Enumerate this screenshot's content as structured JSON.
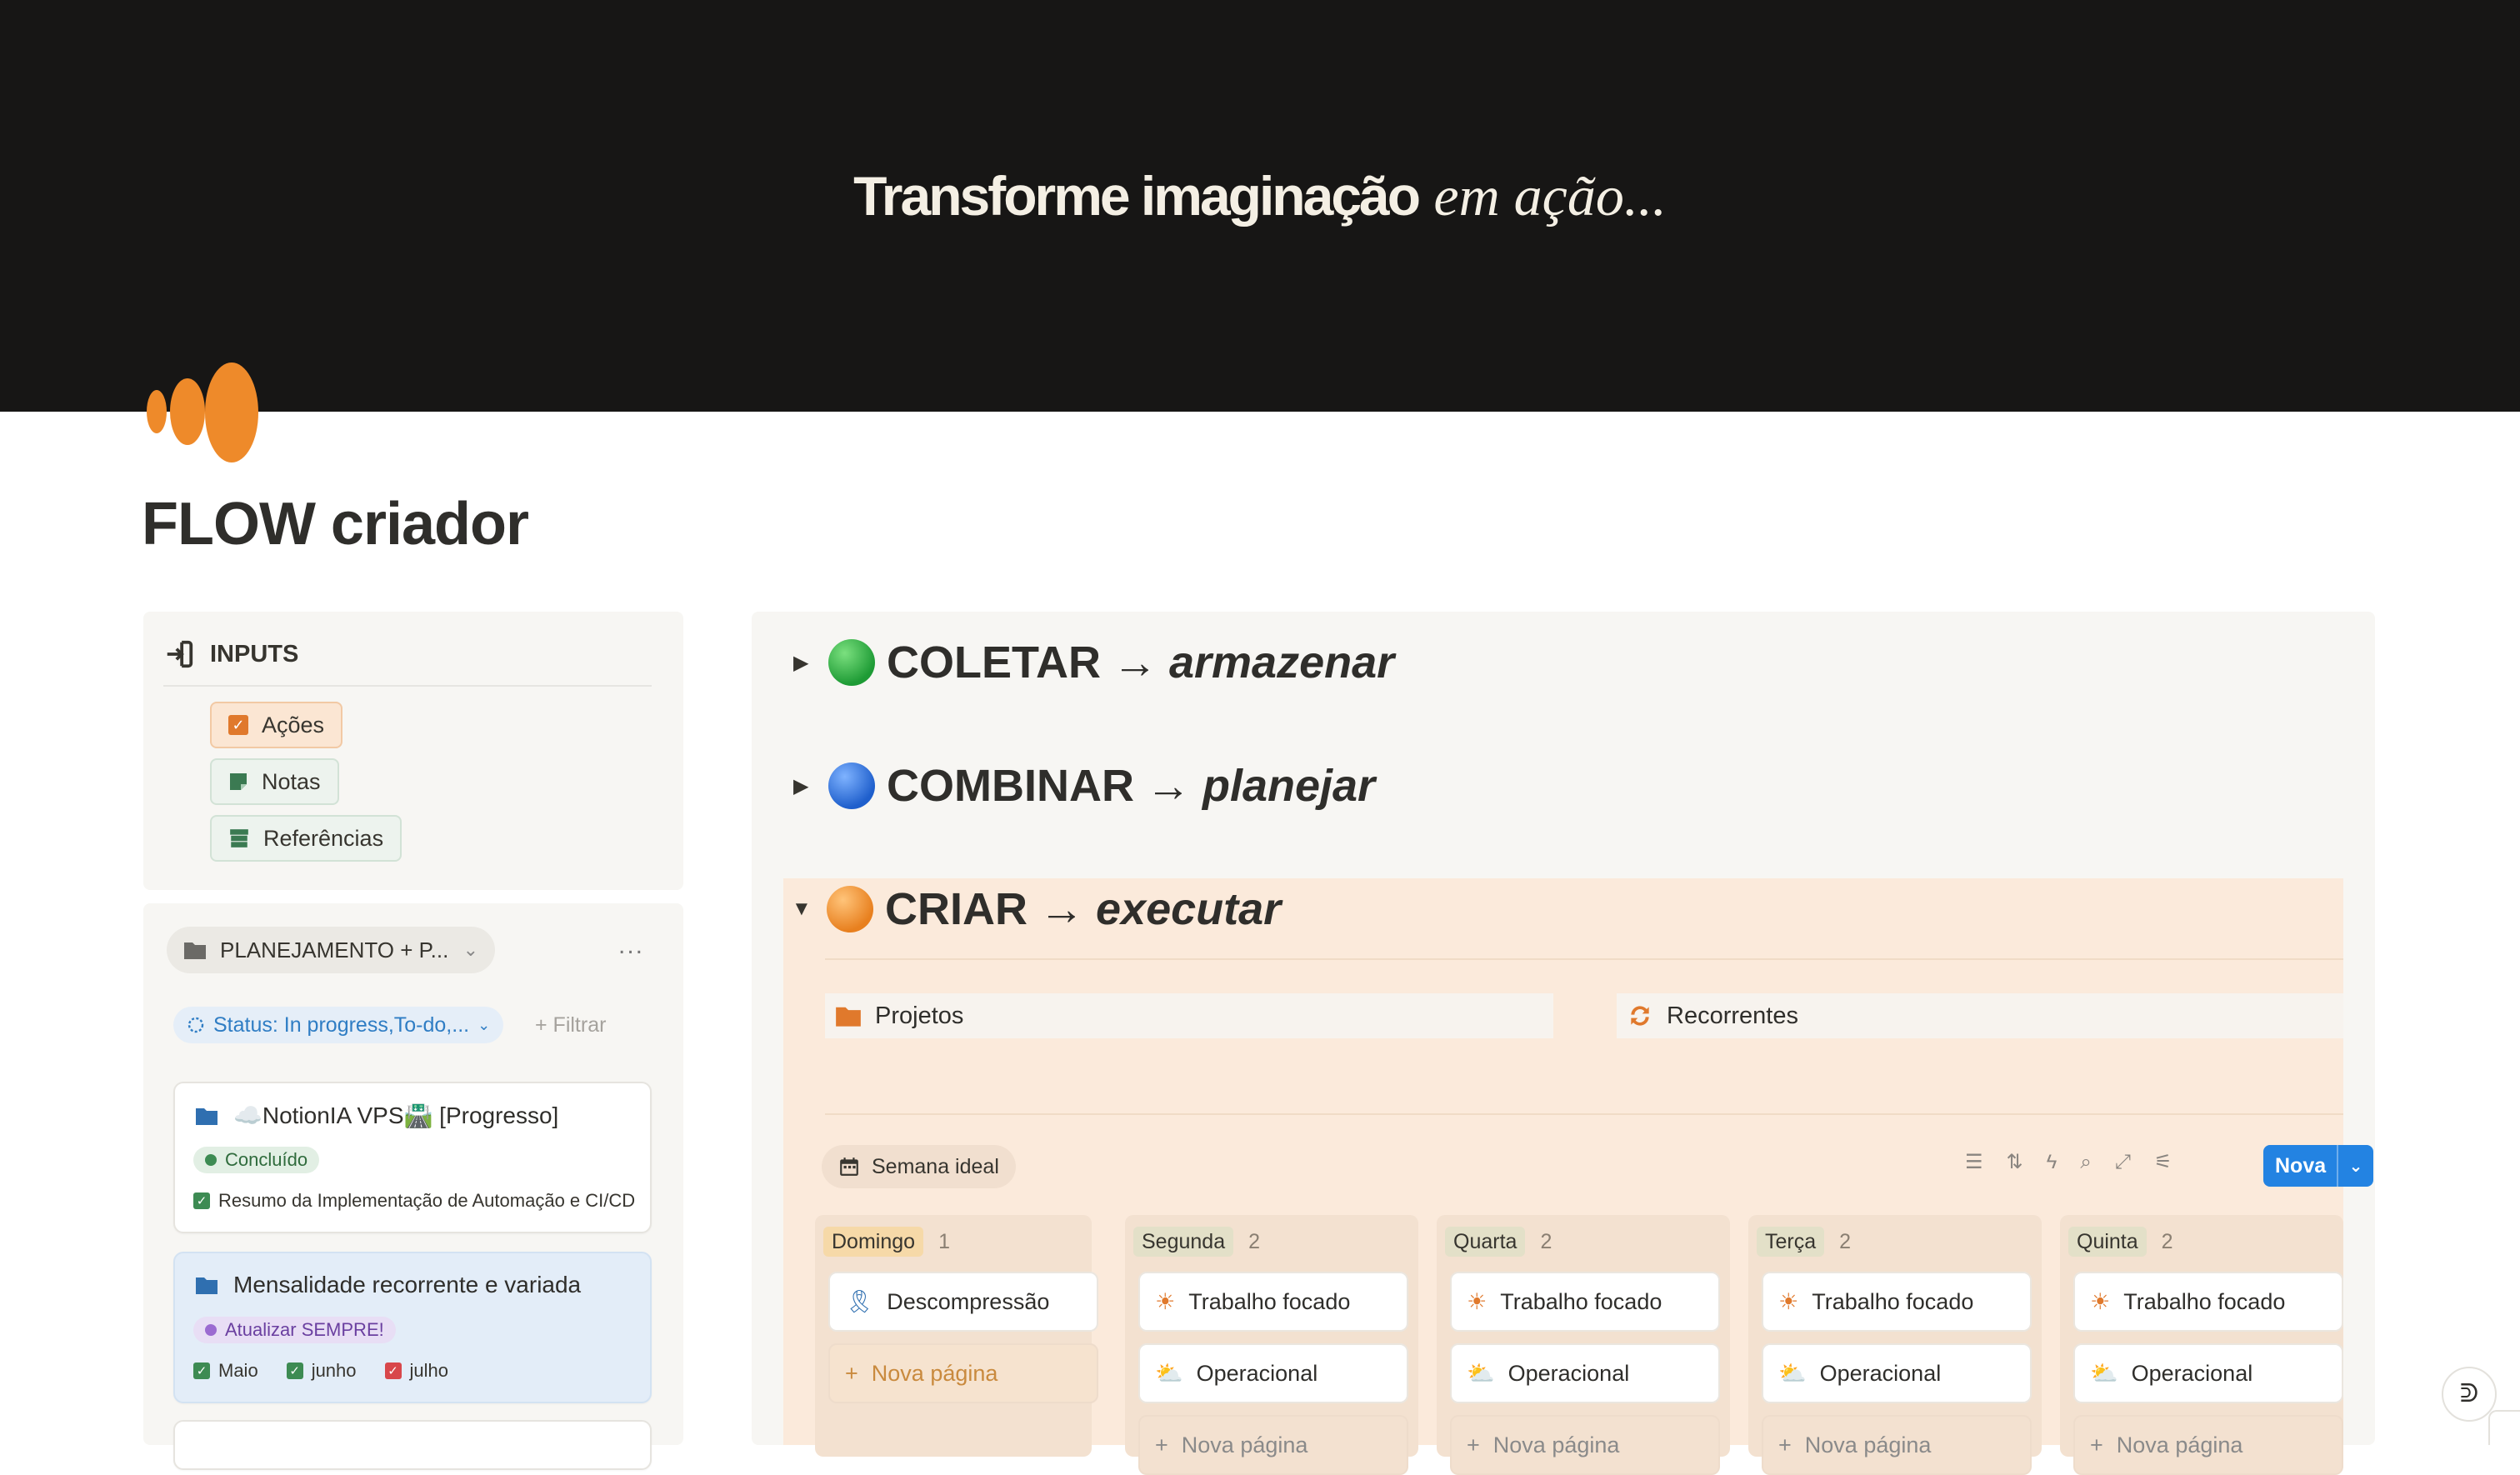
{
  "cover": {
    "title_bold": "Transforme imaginação",
    "title_italic": "em ação..."
  },
  "page": {
    "title": "FLOW criador"
  },
  "inputs": {
    "heading": "INPUTS",
    "items": [
      {
        "label": "Ações",
        "icon": "checkbox-icon",
        "color": "#e0792c"
      },
      {
        "label": "Notas",
        "icon": "note-icon",
        "color": "#3b7a52"
      },
      {
        "label": "Referências",
        "icon": "archive-icon",
        "color": "#3b7a52"
      }
    ]
  },
  "planning": {
    "view_label": "PLANEJAMENTO + P...",
    "more": "...",
    "status_filter": "Status: In progress,To-do,...",
    "add_filter": "+ Filtrar",
    "cards": [
      {
        "title": "☁️NotionIA VPS🛣️ [Progresso]",
        "tag": "Concluído",
        "relation": "Resumo da Implementação de Automação e CI/CD"
      },
      {
        "title": "Mensalidade recorrente e variada",
        "tag": "Atualizar SEMPRE!",
        "relations": [
          "Maio",
          "junho",
          "julho"
        ]
      }
    ]
  },
  "toggles": [
    {
      "emoji_color": "#2fa742",
      "main": "COLETAR",
      "arrow": "→",
      "sub": "armazenar",
      "state": "collapsed"
    },
    {
      "emoji_color": "#2f6fd6",
      "main": "COMBINAR",
      "arrow": "→",
      "sub": "planejar",
      "state": "collapsed"
    },
    {
      "emoji_color": "#ee8a2a",
      "main": "CRIAR",
      "arrow": "→",
      "sub": "executar",
      "state": "expanded"
    }
  ],
  "criar": {
    "links": [
      {
        "label": "Projetos",
        "icon": "folder-icon"
      },
      {
        "label": "Recorrentes",
        "icon": "repeat-icon"
      }
    ],
    "view_tab": "Semana ideal",
    "new_button": "Nova",
    "new_page": "Nova página",
    "columns": [
      {
        "label": "Domingo",
        "count": "1",
        "label_bg": "#f6d9a8",
        "cards": [
          {
            "title": "Descompressão",
            "icon": "ribbon-icon"
          }
        ]
      },
      {
        "label": "Segunda",
        "count": "2",
        "label_bg": "#e3e0c8",
        "cards": [
          {
            "title": "Trabalho focado",
            "icon": "sun-icon"
          },
          {
            "title": "Operacional",
            "icon": "cloud-sun-icon"
          }
        ]
      },
      {
        "label": "Quarta",
        "count": "2",
        "label_bg": "#e3e0c8",
        "cards": [
          {
            "title": "Trabalho focado",
            "icon": "sun-icon"
          },
          {
            "title": "Operacional",
            "icon": "cloud-sun-icon"
          }
        ]
      },
      {
        "label": "Terça",
        "count": "2",
        "label_bg": "#e3e0c8",
        "cards": [
          {
            "title": "Trabalho focado",
            "icon": "sun-icon"
          },
          {
            "title": "Operacional",
            "icon": "cloud-sun-icon"
          }
        ]
      },
      {
        "label": "Quinta",
        "count": "2",
        "label_bg": "#e3e0c8",
        "cards": [
          {
            "title": "Trabalho focado",
            "icon": "sun-icon"
          },
          {
            "title": "Operacional",
            "icon": "cloud-sun-icon"
          }
        ]
      }
    ]
  },
  "colors": {
    "accent_orange": "#ee8a2a",
    "cover_bg": "#171615",
    "nova_blue": "#2383e2"
  }
}
